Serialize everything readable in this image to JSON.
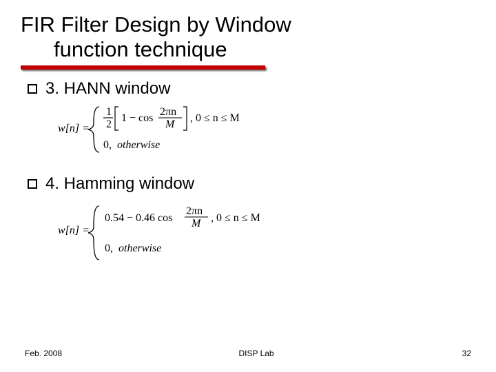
{
  "title": {
    "line1": "FIR Filter Design by Window",
    "line2": "function technique"
  },
  "bullets": {
    "b1": "3. HANN window",
    "b2": "4. Hamming window"
  },
  "formulas": {
    "hann": {
      "lhs": "w[n] =",
      "coeff_top": "1",
      "coeff_bot": "2",
      "bracket_left_expr": "1 − cos",
      "frac_top": "2πn",
      "frac_bot": "M",
      "cond_main": ", 0 ≤ n ≤ M",
      "else_value": "0,",
      "else_label": "otherwise"
    },
    "hamming": {
      "lhs": "w[n] =",
      "expr": "0.54 − 0.46 cos",
      "frac_top": "2πn",
      "frac_bot": "M",
      "cond_main": ", 0 ≤ n ≤ M",
      "else_value": "0,",
      "else_label": "otherwise"
    }
  },
  "footer": {
    "date": "Feb. 2008",
    "center": "DISP Lab",
    "page": "32"
  }
}
